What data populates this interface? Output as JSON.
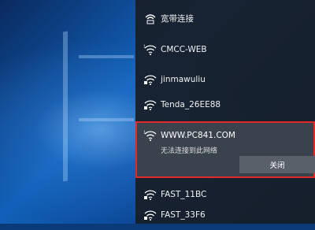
{
  "panel": {
    "header": {
      "label": "宽带连接",
      "icon": "ethernet-dialup-icon"
    },
    "networks": [
      {
        "ssid": "CMCC-WEB",
        "icon": "wifi-open-icon",
        "secured": false
      },
      {
        "ssid": "jinmawuliu",
        "icon": "wifi-secured-icon",
        "secured": true
      },
      {
        "ssid": "Tenda_26EE88",
        "icon": "wifi-secured-icon",
        "secured": true
      }
    ],
    "selected": {
      "ssid": "WWW.PC841.COM",
      "status": "无法连接到此网络",
      "close_label": "关闭",
      "icon": "wifi-open-icon"
    },
    "networks_below": [
      {
        "ssid": "FAST_11BC",
        "icon": "wifi-secured-icon"
      },
      {
        "ssid": "FAST_33F6",
        "icon": "wifi-secured-icon"
      }
    ]
  },
  "colors": {
    "highlight_border": "#e02a2a",
    "panel_bg": "#181e28"
  }
}
